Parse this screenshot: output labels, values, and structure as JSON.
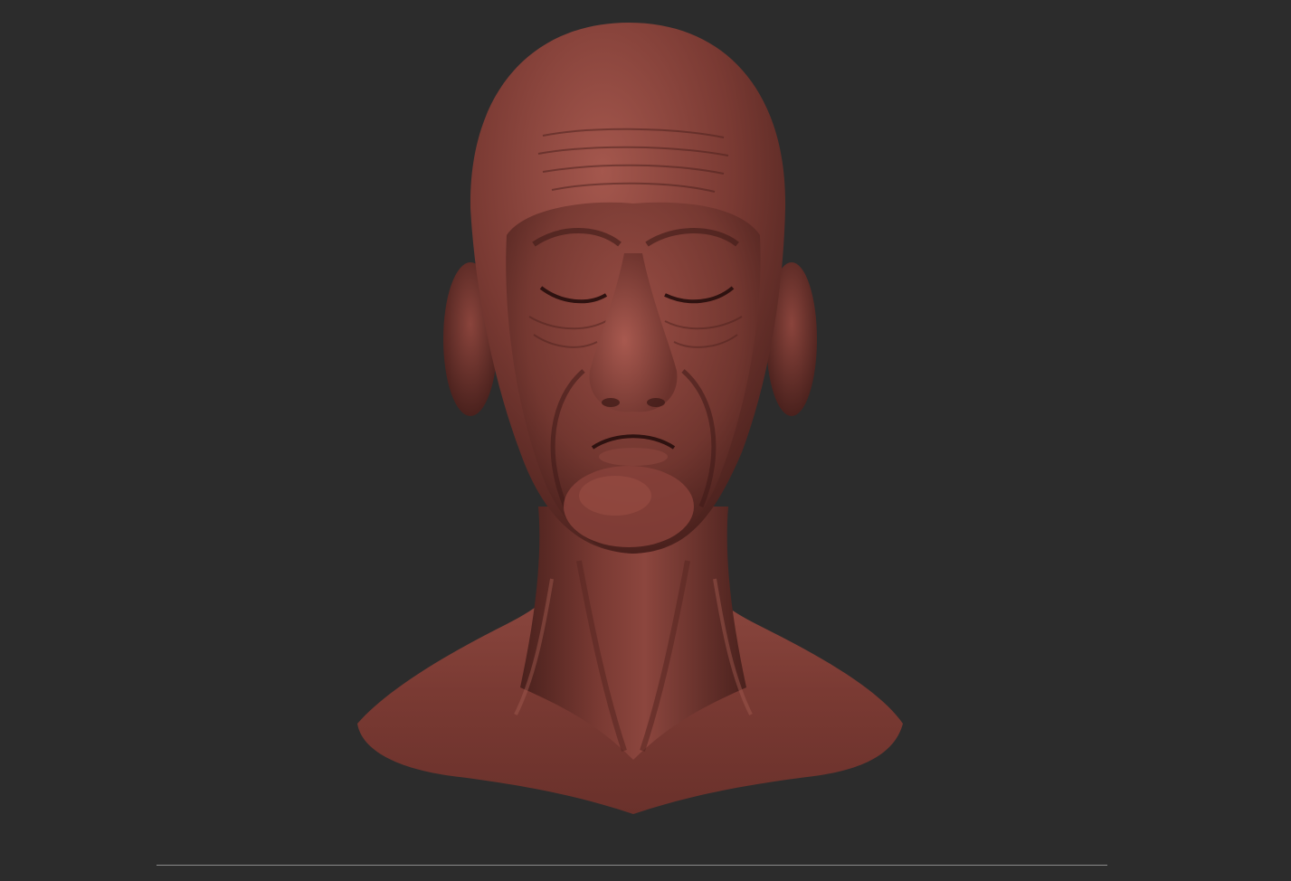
{
  "viewport": {
    "background_color": "#2c2c2c",
    "model": {
      "icon": "sculpted-head-bust-icon",
      "material_color": "#7a3a33",
      "highlight_color": "#a4574d",
      "shadow_color": "#3e1a17"
    },
    "timeline_color": "#8a8a8a"
  }
}
